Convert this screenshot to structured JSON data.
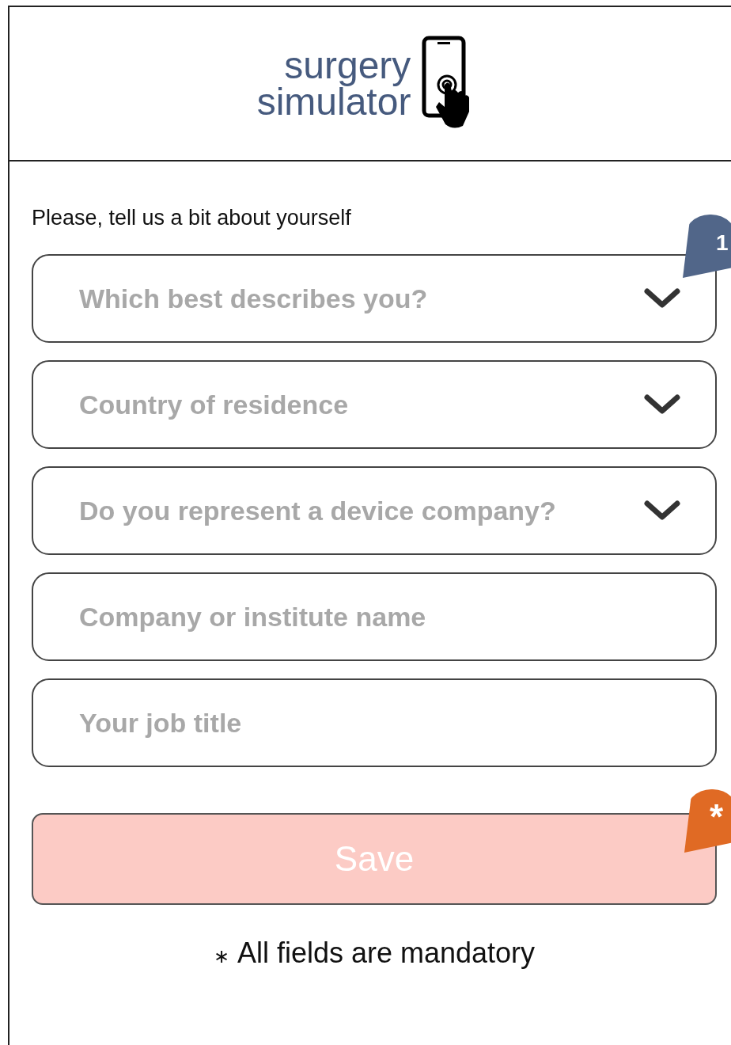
{
  "header": {
    "logo_line_1": "surgery",
    "logo_line_2": "simulator"
  },
  "intro": "Please, tell us a bit about yourself",
  "fields": [
    {
      "kind": "select",
      "placeholder": "Which best describes you?",
      "annotation": "1"
    },
    {
      "kind": "select",
      "placeholder": "Country of residence"
    },
    {
      "kind": "select",
      "placeholder": "Do you represent a device company?"
    },
    {
      "kind": "input",
      "placeholder": "Company or institute name"
    },
    {
      "kind": "input",
      "placeholder": "Your job title"
    }
  ],
  "save_button": {
    "label": "Save",
    "disabled": true,
    "annotation": "*"
  },
  "footer": {
    "mark": "∗",
    "text": "All fields are mandatory"
  }
}
